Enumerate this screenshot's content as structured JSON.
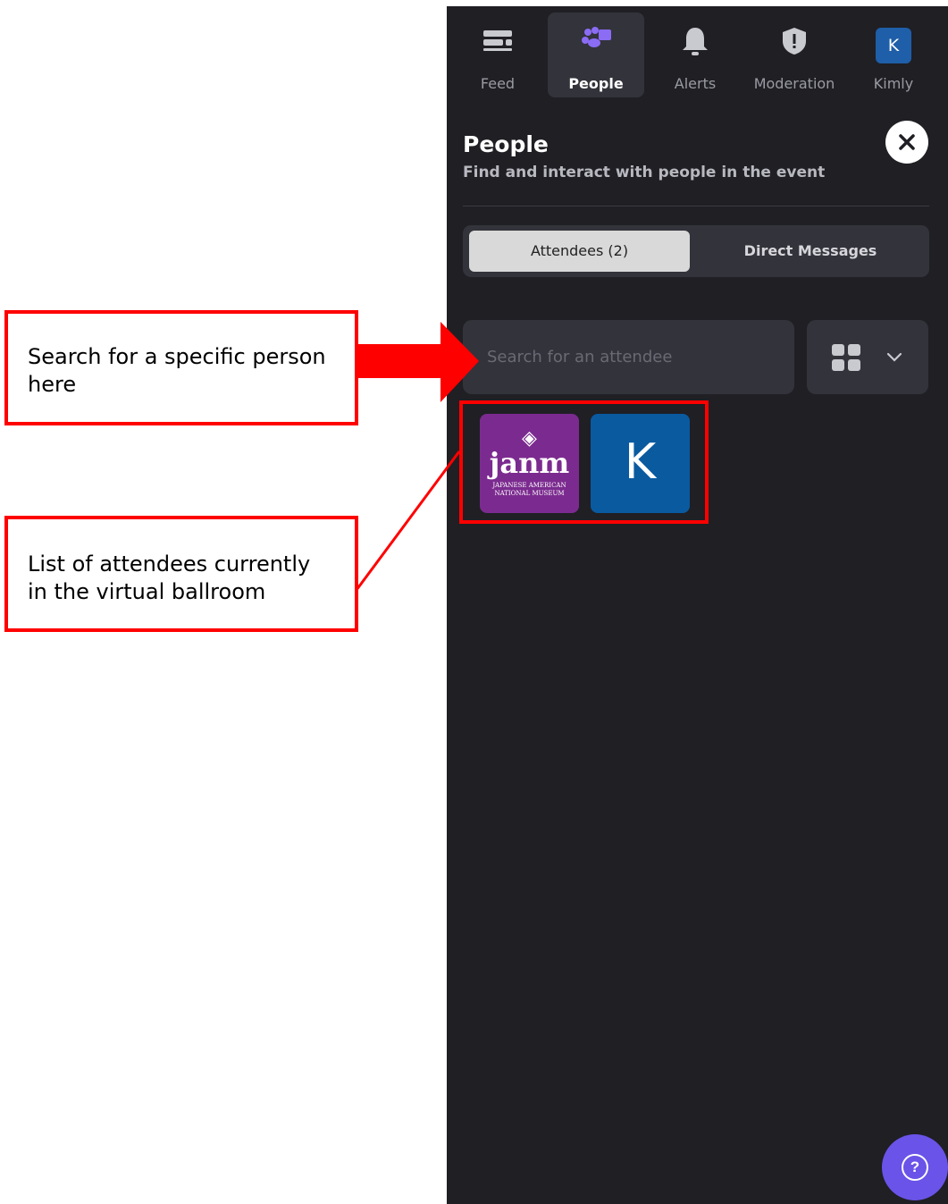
{
  "nav": {
    "items": [
      {
        "label": "Feed",
        "icon": "feed-icon"
      },
      {
        "label": "People",
        "icon": "people-icon",
        "active": true
      },
      {
        "label": "Alerts",
        "icon": "bell-icon"
      },
      {
        "label": "Moderation",
        "icon": "shield-icon"
      },
      {
        "label": "Kimly",
        "icon": "user-avatar",
        "avatar_letter": "K"
      }
    ]
  },
  "panel": {
    "title": "People",
    "subtitle": "Find and interact with people in the event"
  },
  "tabs": {
    "attendees": "Attendees (2)",
    "messages": "Direct Messages"
  },
  "search": {
    "placeholder": "Search for an attendee"
  },
  "attendees": [
    {
      "logo_text": "janm",
      "logo_sub_1": "JAPANESE AMERICAN",
      "logo_sub_2": "NATIONAL MUSEUM"
    },
    {
      "letter": "K"
    }
  ],
  "help": {
    "glyph": "?"
  },
  "annotations": {
    "search_note": "Search for a specific person here",
    "list_note": "List of attendees currently in the virtual ballroom"
  },
  "colors": {
    "panel_bg": "#1f1f24",
    "accent": "#8b6cf5",
    "annotation_red": "#ff0000",
    "help_button": "#6a53e8"
  }
}
